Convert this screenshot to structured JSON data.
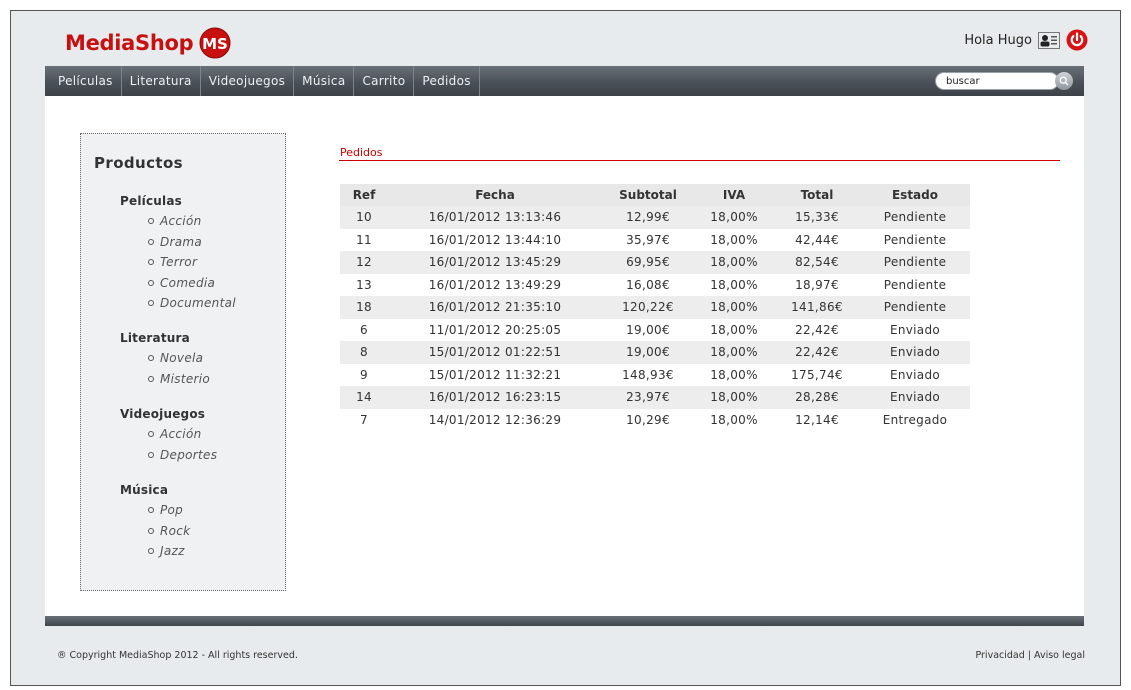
{
  "header": {
    "logo_text": "MediaShop",
    "logo_badge": "MS",
    "greeting": "Hola Hugo",
    "brand_color": "#c81010",
    "user_icon": "user-card-icon",
    "logout_icon": "power-icon"
  },
  "nav": {
    "items": [
      "Películas",
      "Literatura",
      "Videojuegos",
      "Música",
      "Carrito",
      "Pedidos"
    ],
    "search_value": "buscar",
    "search_icon": "search-icon"
  },
  "sidebar": {
    "title": "Productos",
    "categories": [
      {
        "title": "Películas",
        "items": [
          "Acción",
          "Drama",
          "Terror",
          "Comedia",
          "Documental"
        ]
      },
      {
        "title": "Literatura",
        "items": [
          "Novela",
          "Misterio"
        ]
      },
      {
        "title": "Videojuegos",
        "items": [
          "Acción",
          "Deportes"
        ]
      },
      {
        "title": "Música",
        "items": [
          "Pop",
          "Rock",
          "Jazz"
        ]
      }
    ]
  },
  "main": {
    "title": "Pedidos",
    "accent_color": "#cc0000",
    "columns": [
      "Ref",
      "Fecha",
      "Subtotal",
      "IVA",
      "Total",
      "Estado"
    ],
    "rows": [
      [
        "10",
        "16/01/2012 13:13:46",
        "12,99€",
        "18,00%",
        "15,33€",
        "Pendiente"
      ],
      [
        "11",
        "16/01/2012 13:44:10",
        "35,97€",
        "18,00%",
        "42,44€",
        "Pendiente"
      ],
      [
        "12",
        "16/01/2012 13:45:29",
        "69,95€",
        "18,00%",
        "82,54€",
        "Pendiente"
      ],
      [
        "13",
        "16/01/2012 13:49:29",
        "16,08€",
        "18,00%",
        "18,97€",
        "Pendiente"
      ],
      [
        "18",
        "16/01/2012 21:35:10",
        "120,22€",
        "18,00%",
        "141,86€",
        "Pendiente"
      ],
      [
        "6",
        "11/01/2012 20:25:05",
        "19,00€",
        "18,00%",
        "22,42€",
        "Enviado"
      ],
      [
        "8",
        "15/01/2012 01:22:51",
        "19,00€",
        "18,00%",
        "22,42€",
        "Enviado"
      ],
      [
        "9",
        "15/01/2012 11:32:21",
        "148,93€",
        "18,00%",
        "175,74€",
        "Enviado"
      ],
      [
        "14",
        "16/01/2012 16:23:15",
        "23,97€",
        "18,00%",
        "28,28€",
        "Enviado"
      ],
      [
        "7",
        "14/01/2012 12:36:29",
        "10,29€",
        "18,00%",
        "12,14€",
        "Entregado"
      ]
    ]
  },
  "footer": {
    "copyright": "® Copyright MediaShop 2012 - All rights reserved.",
    "privacy": "Privacidad",
    "separator": "|",
    "legal": "Aviso legal"
  }
}
